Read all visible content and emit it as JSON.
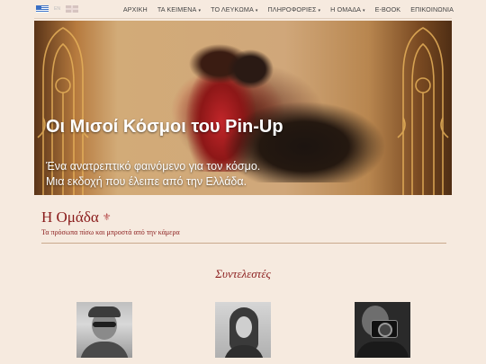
{
  "languages": [
    {
      "code": "el",
      "label": "EL"
    },
    {
      "code": "en",
      "label": "EN"
    }
  ],
  "nav": {
    "items": [
      {
        "label": "ΑΡΧΙΚΗ",
        "dropdown": false
      },
      {
        "label": "ΤΑ ΚΕΙΜΕΝΑ",
        "dropdown": true
      },
      {
        "label": "ΤΟ ΛΕΥΚΩΜΑ",
        "dropdown": true
      },
      {
        "label": "ΠΛΗΡΟΦΟΡΙΕΣ",
        "dropdown": true
      },
      {
        "label": "Η ΟΜΑΔΑ",
        "dropdown": true
      },
      {
        "label": "E-BOOK",
        "dropdown": false
      },
      {
        "label": "ΕΠΙΚΟΙΝΩΝΙΑ",
        "dropdown": false
      }
    ],
    "caret": "▾"
  },
  "hero": {
    "title": "Οι Μισοί Κόσμοι του Pin-Up",
    "subtitle_line1": "Ένα ανατρεπτικό φαινόμενο για τον κόσμο.",
    "subtitle_line2": "Μια εκδοχή που έλειπε από την Ελλάδα."
  },
  "section": {
    "title": "Η Ομάδα",
    "fleur": "⚜",
    "subtitle": "Τα πρόσωπα πίσω και μπροστά από την κάμερα"
  },
  "credits": {
    "title": "Συντελεστές",
    "avatars": [
      {
        "icon": "avatar-man-hat-sunglasses"
      },
      {
        "icon": "avatar-woman"
      },
      {
        "icon": "avatar-photographer-camera"
      }
    ]
  },
  "colors": {
    "background": "#f6eadf",
    "accent": "#8a1c1c",
    "nav_text": "#444444"
  }
}
